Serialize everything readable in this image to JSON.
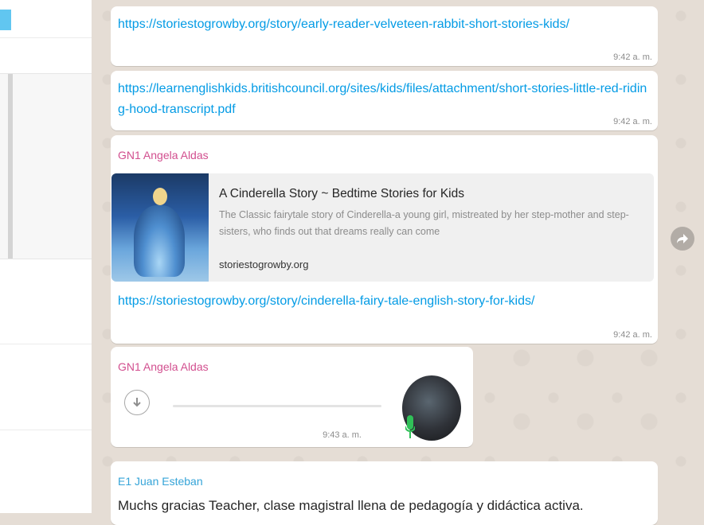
{
  "messages": {
    "m1": {
      "link": "https://storiestogrowby.org/story/early-reader-velveteen-rabbit-short-stories-kids/",
      "time": "9:42 a. m."
    },
    "m2": {
      "link": "https://learnenglishkids.britishcouncil.org/sites/kids/files/attachment/short-stories-little-red-riding-hood-transcript.pdf",
      "time": "9:42 a. m."
    },
    "m3": {
      "sender": "GN1 Angela Aldas",
      "preview_title": "A Cinderella Story ~ Bedtime Stories for Kids",
      "preview_desc": "The Classic fairytale story of Cinderella-a young girl, mistreated by her step-mother and step-sisters, who finds out that dreams really can come",
      "preview_domain": "storiestogrowby.org",
      "link": "https://storiestogrowby.org/story/cinderella-fairy-tale-english-story-for-kids/",
      "time": "9:42 a. m."
    },
    "m4": {
      "sender": "GN1 Angela Aldas",
      "time": "9:43 a. m.",
      "download_icon": "download-arrow-icon",
      "mic_icon": "microphone-icon"
    },
    "m5": {
      "sender": "E1 Juan Esteban",
      "text": "Muchs gracias Teacher, clase magistral llena de pedagogía y didáctica activa."
    }
  },
  "icons": {
    "forward": "forward-arrow-icon"
  },
  "colors": {
    "link": "#039be5",
    "sender_pink": "#d24f8f",
    "sender_blue": "#35a4d8",
    "mic_green": "#30c058",
    "chat_bg": "#e5ddd5"
  }
}
